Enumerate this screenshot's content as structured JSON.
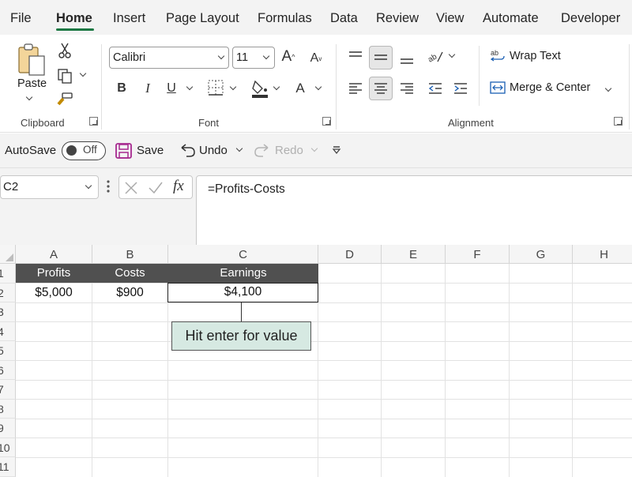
{
  "menu": {
    "tabs": [
      "File",
      "Home",
      "Insert",
      "Page Layout",
      "Formulas",
      "Data",
      "Review",
      "View",
      "Automate",
      "Developer"
    ],
    "active_tab": "Home"
  },
  "ribbon": {
    "clipboard": {
      "paste_label": "Paste",
      "group_label": "Clipboard"
    },
    "font": {
      "font_name": "Calibri",
      "font_size": "11",
      "group_label": "Font",
      "grow": "A",
      "shrink": "A",
      "bold": "B",
      "italic": "I",
      "underline": "U",
      "color_letter": "A"
    },
    "alignment": {
      "wrap_text": "Wrap Text",
      "merge_center": "Merge & Center",
      "group_label": "Alignment"
    }
  },
  "qat": {
    "autosave_label": "AutoSave",
    "autosave_state": "Off",
    "save_label": "Save",
    "undo_label": "Undo",
    "redo_label": "Redo"
  },
  "formula_bar": {
    "name_box": "C2",
    "formula": "=Profits-Costs",
    "fx": "fx"
  },
  "sheet": {
    "columns": [
      "A",
      "B",
      "C",
      "D",
      "E",
      "F",
      "G",
      "H"
    ],
    "rows": [
      "1",
      "2",
      "3",
      "4",
      "5",
      "6",
      "7",
      "8",
      "9",
      "10",
      "11"
    ],
    "headers": [
      "Profits",
      "Costs",
      "Earnings"
    ],
    "values": [
      "$5,000",
      "$900",
      "$4,100"
    ],
    "callout": "Hit enter for value"
  },
  "colors": {
    "accent": "#1d7844",
    "header_fill": "#505050",
    "callout_fill": "#d6e9e2",
    "save_icon": "#a6298f"
  }
}
